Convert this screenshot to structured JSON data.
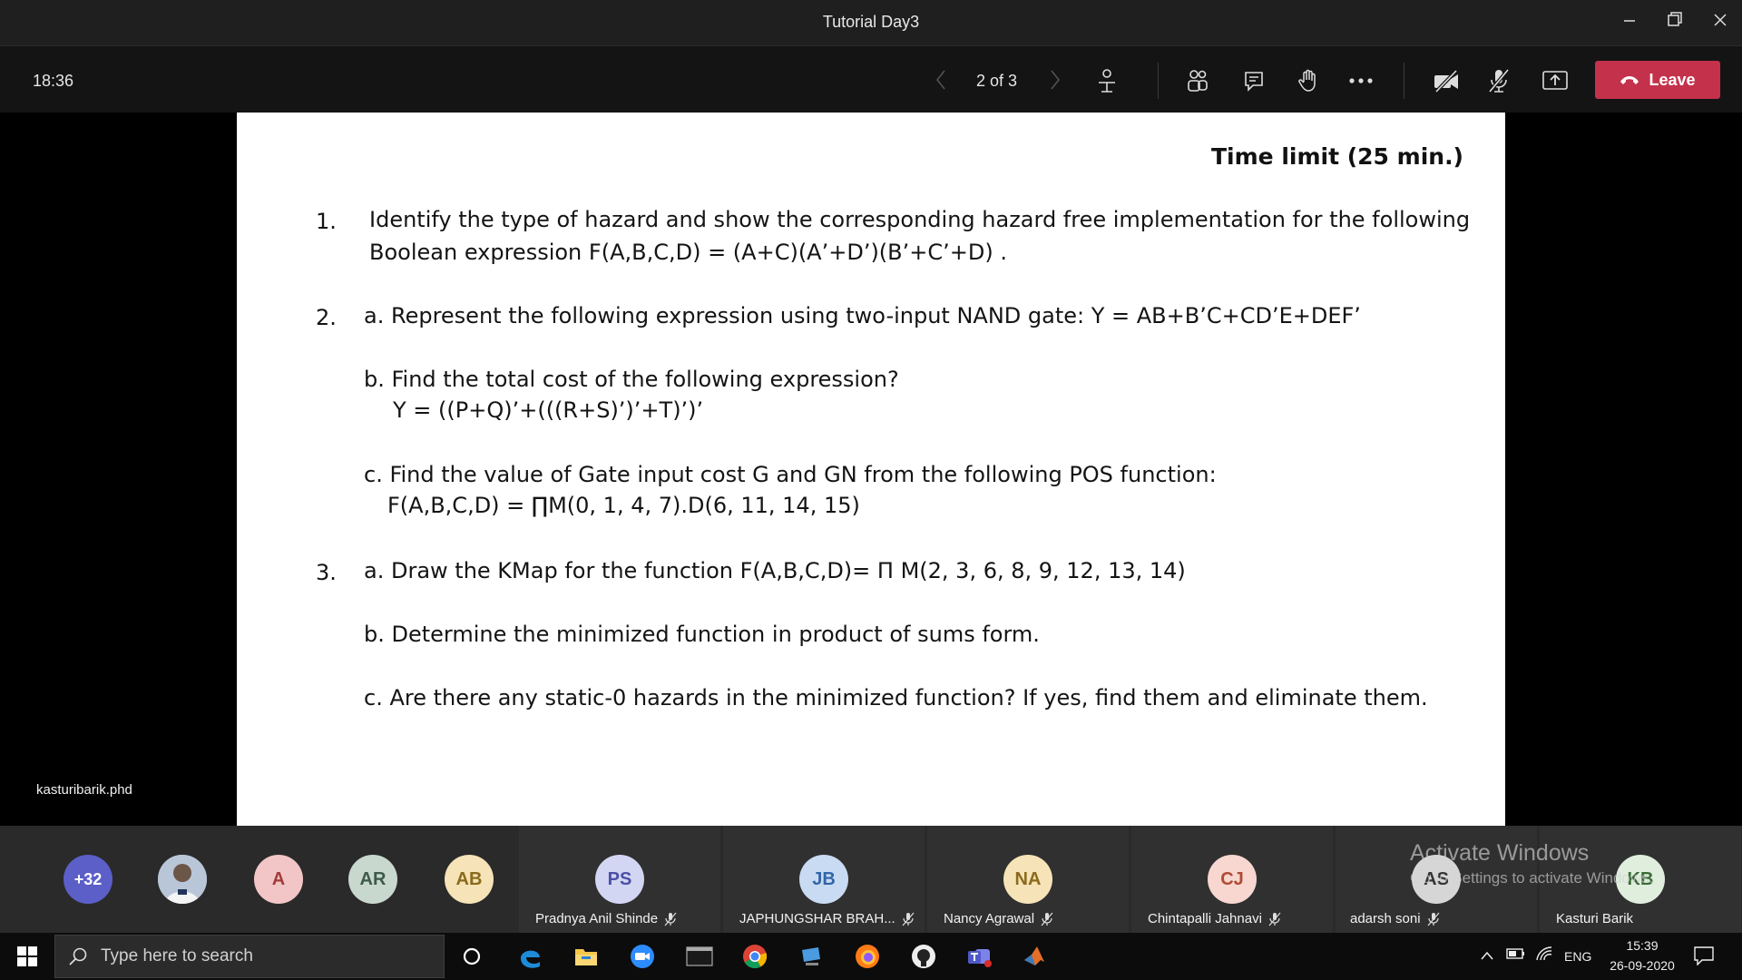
{
  "window": {
    "title": "Tutorial Day3"
  },
  "toolbar": {
    "clock": "18:36",
    "pager": "2 of 3",
    "leave_label": "Leave"
  },
  "slide": {
    "time_limit": "Time limit (25 min.)",
    "q1_num": "1.",
    "q1_line1": "Identify the type of hazard and show the corresponding hazard free implementation for the following",
    "q1_line2": "Boolean expression F(A,B,C,D) = (A+C)(A’+D’)(B’+C’+D) .",
    "q2_num": "2.",
    "q2a": "a. Represent the following expression using two-input NAND gate: Y = AB+B’C+CD’E+DEF’",
    "q2b_line1": "b. Find the total cost of the following expression?",
    "q2b_line2": "Y = ((P+Q)’+(((R+S)’)’+T)’)’",
    "q2c_line1": "c. Find the value of Gate input cost G and GN from the following POS function:",
    "q2c_line2": "F(A,B,C,D) = ∏M(0, 1, 4, 7).D(6, 11, 14, 15)",
    "q3_num": "3.",
    "q3a": "a. Draw the KMap for the function F(A,B,C,D)= Π M(2, 3, 6, 8, 9, 12, 13, 14)",
    "q3b": "b. Determine the minimized function in product of sums form.",
    "q3c": "c. Are there any static-0 hazards in the minimized function? If yes, find them and eliminate them."
  },
  "presenter": "kasturibarik.phd",
  "participants": {
    "overflow": "+32",
    "small": [
      {
        "initials": "A",
        "bg": "#f2c6c6",
        "fg": "#a33a3a"
      },
      {
        "initials": "AR",
        "bg": "#c9d8cf",
        "fg": "#3d5a48"
      },
      {
        "initials": "AB",
        "bg": "#f6e3b7",
        "fg": "#8a6a1c"
      }
    ],
    "tiles": [
      {
        "initials": "PS",
        "name": "Pradnya Anil Shinde",
        "bg": "#d3d6f3",
        "fg": "#4b50a6"
      },
      {
        "initials": "JB",
        "name": "JAPHUNGSHAR BRAH...",
        "bg": "#c9dbf2",
        "fg": "#3366a8"
      },
      {
        "initials": "NA",
        "name": "Nancy Agrawal",
        "bg": "#f6e3b7",
        "fg": "#8a6a1c"
      },
      {
        "initials": "CJ",
        "name": "Chintapalli Jahnavi",
        "bg": "#f7d7d0",
        "fg": "#b04a36"
      },
      {
        "initials": "AS",
        "name": "adarsh soni",
        "bg": "#d6d6d6",
        "fg": "#333333"
      },
      {
        "initials": "KB",
        "name": "Kasturi Barik",
        "bg": "#dfeedd",
        "fg": "#3b6b37"
      }
    ]
  },
  "watermark": {
    "line1": "Activate Windows",
    "line2": "Go to Settings to activate Windows."
  },
  "taskbar": {
    "search_placeholder": "Type here to search",
    "time": "15:39",
    "date": "26-09-2020",
    "lang": "ENG"
  }
}
